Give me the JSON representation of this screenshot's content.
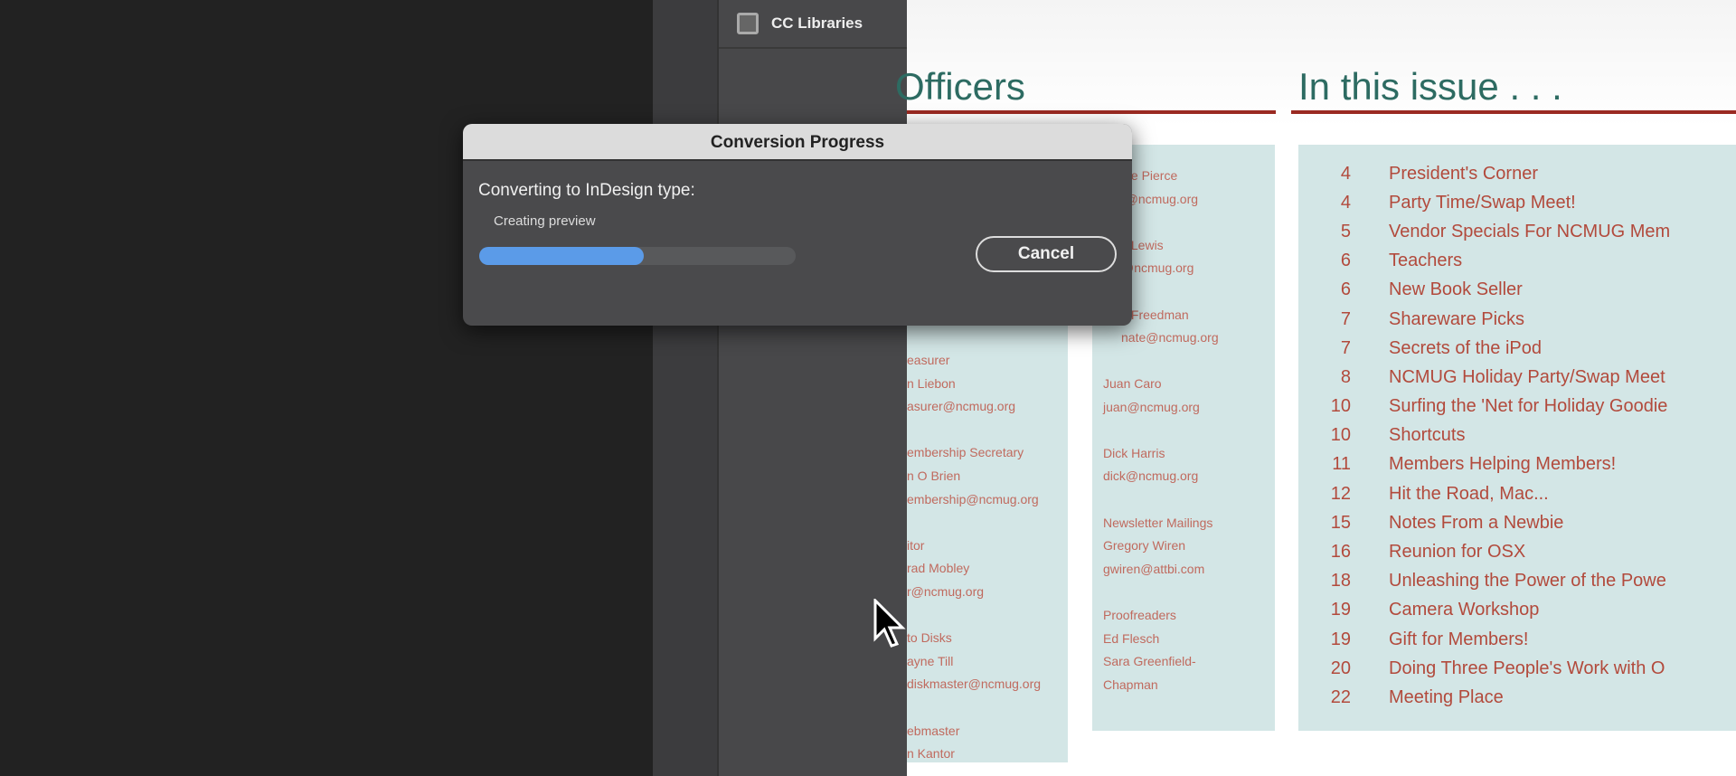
{
  "panel": {
    "cc_libraries": "CC Libraries"
  },
  "document": {
    "officers_title": "Officers",
    "issue_title": "In this issue . . .",
    "officers_col1": "easurer\nn Liebon\nasurer@ncmug.org\n\nembership Secretary\nn O Brien\nembership@ncmug.org\n\nitor\nrad Mobley\nr@ncmug.org\n\nto Disks\nayne Till\ndiskmaster@ncmug.org\n\nebmaster\nn Kantor",
    "officers_col2_top": "die Pierce\nr@ncmug.org\n\ns Lewis\n@ncmug.org\n\ns Freedman\nnate@ncmug.org",
    "officers_col2": "Juan Caro\njuan@ncmug.org\n\nDick Harris\ndick@ncmug.org\n\nNewsletter Mailings\nGregory Wiren\ngwiren@attbi.com\n\nProofreaders\nEd Flesch\nSara Greenfield-\nChapman",
    "issues": [
      {
        "page": "4",
        "title": "President's Corner"
      },
      {
        "page": "4",
        "title": "Party Time/Swap Meet!"
      },
      {
        "page": "5",
        "title": "Vendor Specials For NCMUG Mem"
      },
      {
        "page": "6",
        "title": "Teachers"
      },
      {
        "page": "6",
        "title": "New Book Seller"
      },
      {
        "page": "7",
        "title": "Shareware Picks"
      },
      {
        "page": "7",
        "title": "Secrets of the iPod"
      },
      {
        "page": "8",
        "title": "NCMUG Holiday Party/Swap Meet"
      },
      {
        "page": "10",
        "title": "Surfing the 'Net for Holiday Goodie"
      },
      {
        "page": "10",
        "title": "Shortcuts"
      },
      {
        "page": "11",
        "title": "Members Helping Members!"
      },
      {
        "page": "12",
        "title": "Hit the Road, Mac..."
      },
      {
        "page": "15",
        "title": "Notes From a Newbie"
      },
      {
        "page": "16",
        "title": "Reunion for OSX"
      },
      {
        "page": "18",
        "title": "Unleashing the Power of the Powe"
      },
      {
        "page": "19",
        "title": "Camera Workshop"
      },
      {
        "page": "19",
        "title": "Gift for Members!"
      },
      {
        "page": "20",
        "title": "Doing Three People's Work with O"
      },
      {
        "page": "22",
        "title": "Meeting Place"
      }
    ]
  },
  "dialog": {
    "title": "Conversion Progress",
    "label": "Converting to InDesign type:",
    "status": "Creating preview",
    "progress_percent": 52,
    "cancel": "Cancel",
    "accent": "#5b9be8"
  }
}
